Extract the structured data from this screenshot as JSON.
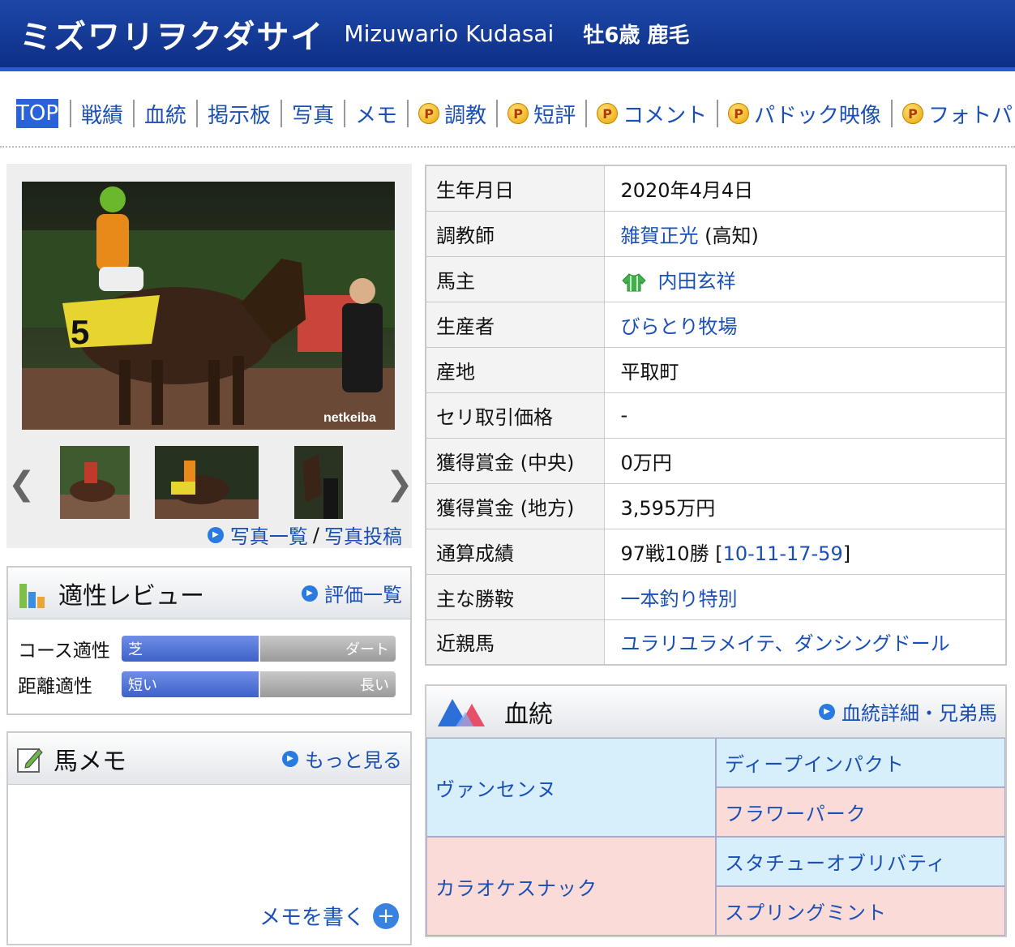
{
  "header": {
    "name_ja": "ミズワリヲクダサイ",
    "name_en": "Mizuwario Kudasai",
    "meta": "牡6歳 鹿毛"
  },
  "nav": {
    "top": "TOP",
    "items": [
      {
        "label": "戦績",
        "premium": false
      },
      {
        "label": "血統",
        "premium": false
      },
      {
        "label": "掲示板",
        "premium": false
      },
      {
        "label": "写真",
        "premium": false
      },
      {
        "label": "メモ",
        "premium": false
      },
      {
        "label": "調教",
        "premium": true
      },
      {
        "label": "短評",
        "premium": true
      },
      {
        "label": "コメント",
        "premium": true
      },
      {
        "label": "パドック映像",
        "premium": true
      },
      {
        "label": "フォトパ",
        "premium": true
      }
    ],
    "premium_badge": "P"
  },
  "photos": {
    "watermark": "netkeiba",
    "list_link": "写真一覧",
    "separator": "/",
    "post_link": "写真投稿"
  },
  "aptitude": {
    "title": "適性レビュー",
    "link": "評価一覧",
    "rows": [
      {
        "label": "コース適性",
        "left": "芝",
        "right": "ダート",
        "value_pct": 50
      },
      {
        "label": "距離適性",
        "left": "短い",
        "right": "長い",
        "value_pct": 50
      }
    ]
  },
  "memo": {
    "title": "馬メモ",
    "link": "もっと見る",
    "write": "メモを書く"
  },
  "profile": {
    "birth_label": "生年月日",
    "birth": "2020年4月4日",
    "trainer_label": "調教師",
    "trainer": "雑賀正光",
    "trainer_area": "(高知)",
    "owner_label": "馬主",
    "owner": "内田玄祥",
    "breeder_label": "生産者",
    "breeder": "びらとり牧場",
    "origin_label": "産地",
    "origin": "平取町",
    "auction_label": "セリ取引価格",
    "auction": "-",
    "prize_central_label": "獲得賞金 (中央)",
    "prize_central": "0万円",
    "prize_local_label": "獲得賞金 (地方)",
    "prize_local": "3,595万円",
    "record_label": "通算成績",
    "record_text": "97戦10勝 [",
    "record_link": "10-11-17-59",
    "record_close": "]",
    "wins_label": "主な勝鞍",
    "wins": "一本釣り特別",
    "relatives_label": "近親馬",
    "relatives": "ユラリユラメイテ、ダンシングドール"
  },
  "pedigree": {
    "title": "血統",
    "link": "血統詳細・兄弟馬",
    "sire": "ヴァンセンヌ",
    "sire_sire": "ディープインパクト",
    "sire_dam": "フラワーパーク",
    "dam": "カラオケスナック",
    "dam_sire": "スタチューオブリバティ",
    "dam_dam": "スプリングミント"
  },
  "colors": {
    "header_blue": "#0e2f86",
    "link_blue": "#1a4fb8",
    "male_bg": "#d7eefb",
    "female_bg": "#fadbd8"
  }
}
